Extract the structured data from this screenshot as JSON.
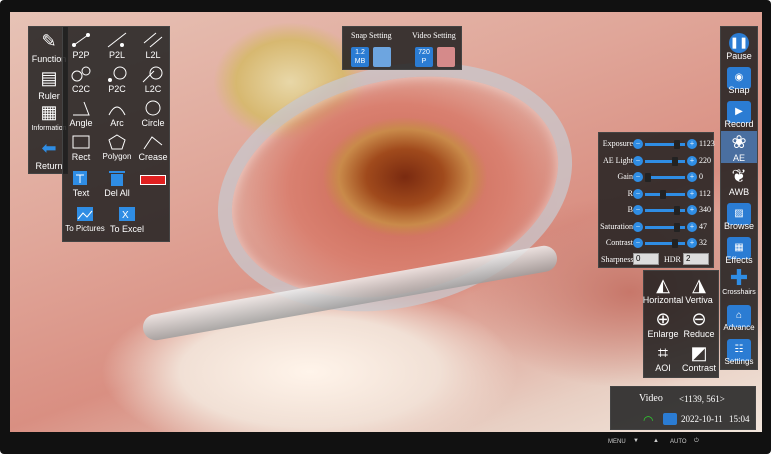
{
  "left_panel": {
    "items": [
      {
        "label": "Function",
        "icon": "function-icon"
      },
      {
        "label": "Ruler",
        "icon": "ruler-icon"
      },
      {
        "label": "Information",
        "icon": "information-icon"
      },
      {
        "label": "Return",
        "icon": "return-icon"
      }
    ]
  },
  "tools": {
    "rows": [
      [
        {
          "label": "P2P"
        },
        {
          "label": "P2L"
        },
        {
          "label": "L2L"
        }
      ],
      [
        {
          "label": "C2C"
        },
        {
          "label": "P2C"
        },
        {
          "label": "L2C"
        }
      ],
      [
        {
          "label": "Angle"
        },
        {
          "label": "Arc"
        },
        {
          "label": "Circle"
        }
      ],
      [
        {
          "label": "Rect"
        },
        {
          "label": "Polygon"
        },
        {
          "label": "Crease"
        }
      ],
      [
        {
          "label": "Text"
        },
        {
          "label": "Del All"
        },
        {
          "label": ""
        }
      ],
      [
        {
          "label": "To Pictures"
        },
        {
          "label": "To Excel"
        }
      ]
    ],
    "color_swatch": "#e02020"
  },
  "settings_top": {
    "snap_label": "Snap Setting",
    "video_label": "Video Setting",
    "snap_badge_top": "1.2",
    "snap_badge_bottom": "MB",
    "video_badge_top": "720",
    "video_badge_bottom": "P"
  },
  "adjust_panel": {
    "rows": [
      {
        "label": "Exposure",
        "value": "1123",
        "level": 0.85
      },
      {
        "label": "AE Light",
        "value": "220",
        "level": 0.8
      },
      {
        "label": "Gain",
        "value": "0",
        "level": 0.0
      },
      {
        "label": "R",
        "value": "112",
        "level": 0.45
      },
      {
        "label": "B",
        "value": "340",
        "level": 0.85
      },
      {
        "label": "Saturation",
        "value": "47",
        "level": 0.85
      },
      {
        "label": "Contrast",
        "value": "32",
        "level": 0.8
      }
    ],
    "sharpness_label": "Sharpness",
    "sharpness_value": "0",
    "hdr_label": "HDR",
    "hdr_value": "2"
  },
  "right_panel": {
    "items": [
      {
        "label": "Pause",
        "icon": "pause-icon"
      },
      {
        "label": "Snap",
        "icon": "camera-icon"
      },
      {
        "label": "Record",
        "icon": "video-camera-icon"
      },
      {
        "label": "AE",
        "icon": "ae-icon"
      },
      {
        "label": "AWB",
        "icon": "awb-icon"
      },
      {
        "label": "Browse",
        "icon": "browse-icon"
      },
      {
        "label": "Effects",
        "icon": "effects-icon"
      },
      {
        "label": "Crosshairs",
        "icon": "crosshair-icon"
      },
      {
        "label": "Advance",
        "icon": "home-icon"
      },
      {
        "label": "Settings",
        "icon": "settings-icon"
      }
    ]
  },
  "view_panel": {
    "items": [
      {
        "label": "Horizontal",
        "icon": "flip-horizontal-icon"
      },
      {
        "label": "Vertiva",
        "icon": "flip-vertical-icon"
      },
      {
        "label": "Enlarge",
        "icon": "zoom-in-icon"
      },
      {
        "label": "Reduce",
        "icon": "zoom-out-icon"
      },
      {
        "label": "AOI",
        "icon": "crop-icon"
      },
      {
        "label": "Contrast",
        "icon": "contrast-icon"
      }
    ]
  },
  "status": {
    "mode": "Video",
    "coords": "<1139, 561>",
    "date": "2022-10-11",
    "time": "15:04"
  },
  "bezel_buttons": [
    "MENU",
    "▼",
    "▲",
    "AUTO",
    "⏻"
  ]
}
